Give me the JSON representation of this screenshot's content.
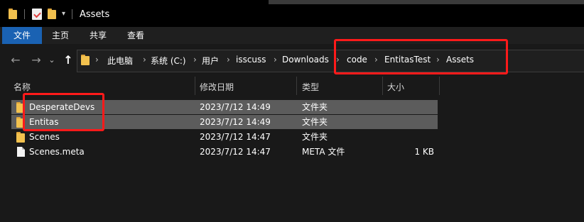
{
  "window": {
    "title": "Assets"
  },
  "ribbon": {
    "tabs": [
      "文件",
      "主页",
      "共享",
      "查看"
    ]
  },
  "nav": {
    "back": "←",
    "forward": "→",
    "recent": "⌄",
    "up": "↑"
  },
  "breadcrumb": [
    "此电脑",
    "系统 (C:)",
    "用户",
    "isscuss",
    "Downloads",
    "code",
    "EntitasTest",
    "Assets"
  ],
  "columns": {
    "name": "名称",
    "modified": "修改日期",
    "type": "类型",
    "size": "大小"
  },
  "files": [
    {
      "name": "DesperateDevs",
      "modified": "2023/7/12 14:49",
      "type": "文件夹",
      "size": "",
      "icon": "folder-icon",
      "selected": true
    },
    {
      "name": "Entitas",
      "modified": "2023/7/12 14:49",
      "type": "文件夹",
      "size": "",
      "icon": "folder-icon",
      "selected": true
    },
    {
      "name": "Scenes",
      "modified": "2023/7/12 14:47",
      "type": "文件夹",
      "size": "",
      "icon": "folder-icon",
      "selected": false
    },
    {
      "name": "Scenes.meta",
      "modified": "2023/7/12 14:47",
      "type": "META 文件",
      "size": "1 KB",
      "icon": "file-icon",
      "selected": false
    }
  ],
  "colors": {
    "accent": "#1a62b3",
    "annotation": "#ff1a1a",
    "folder": "#f2c14e",
    "selection": "#5c5c5c"
  }
}
